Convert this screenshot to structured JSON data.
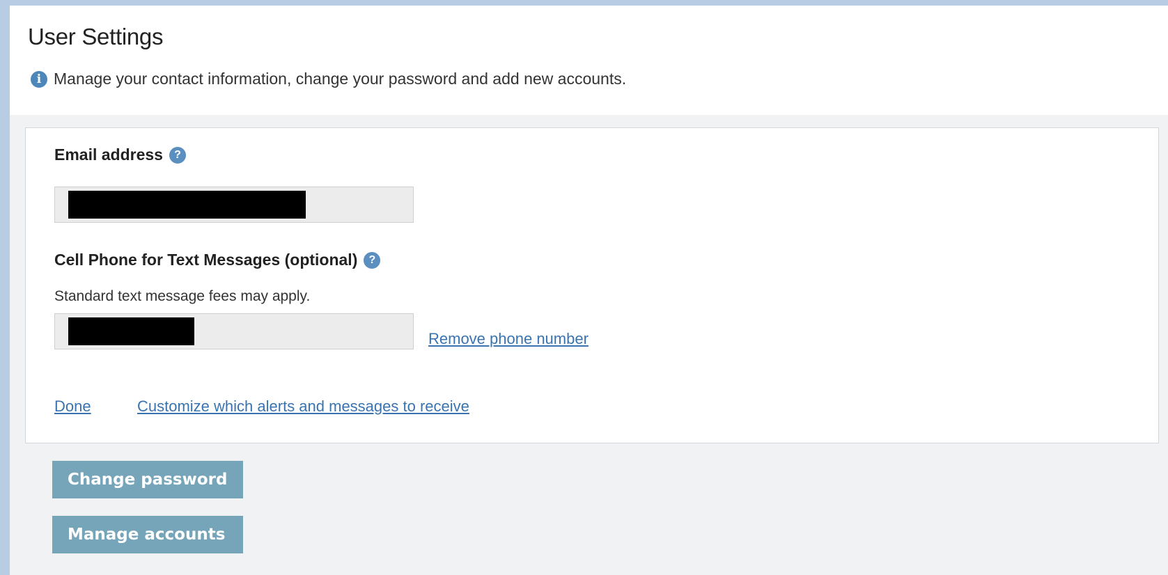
{
  "header": {
    "title": "User Settings",
    "subtitle": "Manage your contact information, change your password and add new accounts.",
    "info_icon": "i"
  },
  "email": {
    "label": "Email address",
    "help_icon": "?",
    "value": ""
  },
  "phone": {
    "label": "Cell Phone for Text Messages (optional)",
    "help_icon": "?",
    "hint": "Standard text message fees may apply.",
    "value": "",
    "remove_link": "Remove phone number"
  },
  "card_actions": {
    "done_link": "Done",
    "customize_link": "Customize which alerts and messages to receive"
  },
  "buttons": {
    "change_password": "Change password",
    "manage_accounts": "Manage accounts"
  },
  "colors": {
    "accent_link": "#3a74b0",
    "button_bg": "#76a4b8",
    "info_icon": "#4d86b8",
    "page_bg": "#f1f2f4"
  }
}
